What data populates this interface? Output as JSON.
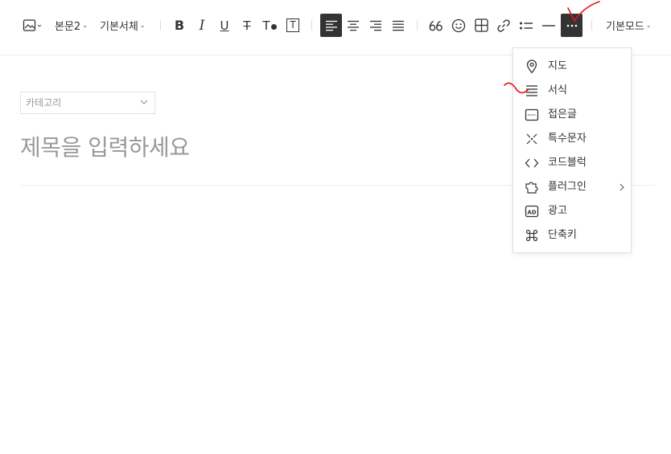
{
  "toolbar": {
    "paragraph_style": "본문2",
    "font_family": "기본서체",
    "mode": "기본모드",
    "buttons": [
      {
        "name": "image-icon"
      },
      {
        "name": "bold",
        "label": "B"
      },
      {
        "name": "italic",
        "label": "I"
      },
      {
        "name": "underline",
        "label": "U"
      },
      {
        "name": "strikethrough",
        "label": "T"
      },
      {
        "name": "text-color",
        "label": "T"
      },
      {
        "name": "text-background",
        "label": "T"
      },
      {
        "name": "align-left",
        "active": true
      },
      {
        "name": "align-center"
      },
      {
        "name": "align-right"
      },
      {
        "name": "align-justify"
      },
      {
        "name": "quote-icon"
      },
      {
        "name": "emoji-icon"
      },
      {
        "name": "table-icon"
      },
      {
        "name": "link-icon"
      },
      {
        "name": "list-icon"
      },
      {
        "name": "horizontal-line-icon"
      },
      {
        "name": "more-icon",
        "active": true
      }
    ]
  },
  "editor": {
    "category_placeholder": "카테고리",
    "title_placeholder": "제목을 입력하세요"
  },
  "more_menu": {
    "items": [
      {
        "label": "지도",
        "icon": "map-pin-icon"
      },
      {
        "label": "서식",
        "icon": "template-icon"
      },
      {
        "label": "접은글",
        "icon": "fold-text-icon"
      },
      {
        "label": "특수문자",
        "icon": "special-char-icon"
      },
      {
        "label": "코드블럭",
        "icon": "code-block-icon"
      },
      {
        "label": "플러그인",
        "icon": "plugin-icon",
        "has_submenu": true
      },
      {
        "label": "광고",
        "icon": "ad-icon"
      },
      {
        "label": "단축키",
        "icon": "shortcut-icon"
      }
    ]
  },
  "colors": {
    "active_bg": "#333333",
    "annotation": "#e0141e",
    "placeholder": "#999999"
  }
}
